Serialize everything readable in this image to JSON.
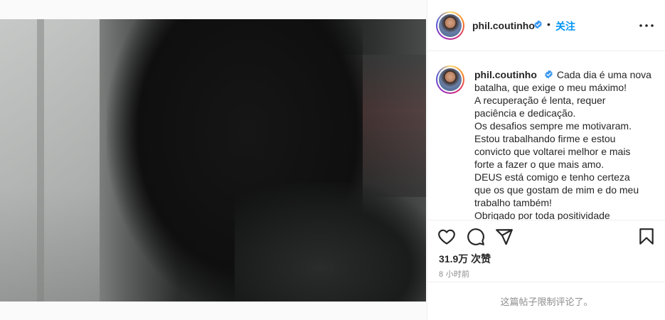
{
  "account": {
    "username": "phil.coutinho",
    "verified": true,
    "follow_label": "关注",
    "separator": "•"
  },
  "caption": {
    "lines": [
      "Cada dia é uma nova",
      "batalha, que exige o meu máximo!",
      "A recuperação é lenta, requer",
      "paciência e dedicação.",
      "Os desafios sempre me motivaram.",
      "Estou trabalhando firme e estou",
      "convicto que voltarei melhor e mais",
      "forte a fazer o que mais amo.",
      "DEUS está comigo e tenho certeza",
      "que os que gostam de mim e do meu",
      "trabalho também!",
      "Obrigado por toda positividade"
    ]
  },
  "stats": {
    "likes": "31.9万 次赞",
    "posted": "8 小时前"
  },
  "comments": {
    "disabled_text": "这篇帖子限制评论了。"
  },
  "icons": {
    "like": "heart-icon",
    "comment": "comment-icon",
    "share": "paper-plane-icon",
    "save": "bookmark-icon",
    "more": "more-options-icon",
    "verified": "verified-badge-icon"
  },
  "colors": {
    "accent": "#0095f6",
    "text": "#262626",
    "muted": "#8e8e8e",
    "border": "#efefef"
  }
}
